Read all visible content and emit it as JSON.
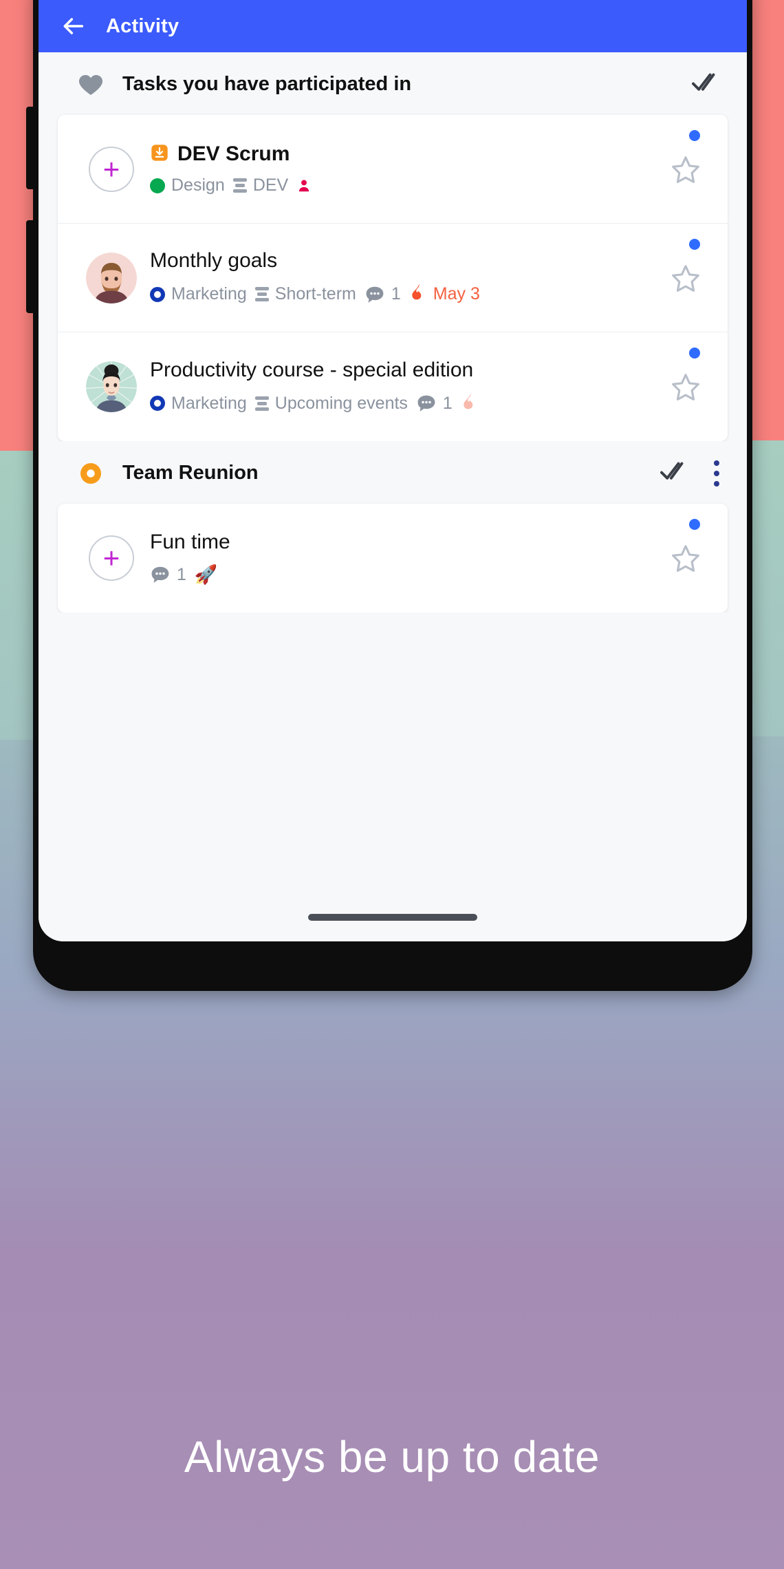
{
  "theme": {
    "accent": "#3b5bfd",
    "caption_color": "#ffffff"
  },
  "appbar": {
    "title": "Activity",
    "back_icon": "arrow-left-icon"
  },
  "sections": [
    {
      "id": "participated",
      "icon": "heart-icon",
      "icon_color": "#8a929e",
      "title": "Tasks you have participated in",
      "actions": {
        "mark_read_icon": "mark-read-icon",
        "overflow_icon": ""
      },
      "tasks": [
        {
          "avatar": "plus-icon",
          "avatar_type": "add",
          "prefix_icon": "inbox-download-icon",
          "prefix_icon_color": "#f7941d",
          "title": "DEV Scrum",
          "bold": true,
          "meta": [
            {
              "type": "status-dot",
              "color": "#06a850",
              "label": "Design"
            },
            {
              "type": "list",
              "label": "DEV"
            },
            {
              "type": "person",
              "color": "#e3004f",
              "label": ""
            }
          ],
          "star": "star-outline-icon",
          "unread": true
        },
        {
          "avatar": "avatar-man",
          "avatar_type": "photo",
          "title": "Monthly goals",
          "bold": false,
          "meta": [
            {
              "type": "status-ring",
              "color": "#1138b5",
              "label": "Marketing"
            },
            {
              "type": "list",
              "label": "Short-term"
            },
            {
              "type": "comment",
              "label": "1"
            },
            {
              "type": "due",
              "icon": "fire-icon",
              "label": "May 3",
              "color": "#f4603f"
            }
          ],
          "star": "star-outline-icon",
          "unread": true
        },
        {
          "avatar": "avatar-woman",
          "avatar_type": "photo",
          "title": "Productivity course - special edition",
          "bold": false,
          "meta": [
            {
              "type": "status-ring",
              "color": "#1138b5",
              "label": "Marketing"
            },
            {
              "type": "list",
              "label": "Upcoming events"
            },
            {
              "type": "comment",
              "label": "1"
            },
            {
              "type": "due",
              "icon": "fire-icon",
              "label": "",
              "color": "#f9b9ab"
            }
          ],
          "star": "star-outline-icon",
          "unread": true
        }
      ]
    },
    {
      "id": "team-reunion",
      "icon": "ring-icon",
      "icon_color": "#f79c1a",
      "title": "Team Reunion",
      "actions": {
        "mark_read_icon": "mark-read-icon",
        "overflow_icon": "more-vertical-icon"
      },
      "tasks": [
        {
          "avatar": "plus-icon",
          "avatar_type": "add",
          "title": "Fun time",
          "bold": false,
          "meta": [
            {
              "type": "comment",
              "label": "1"
            },
            {
              "type": "emoji",
              "label": "🚀"
            }
          ],
          "star": "star-outline-icon",
          "unread": true
        }
      ]
    }
  ],
  "home_indicator": "home-indicator",
  "caption": "Always be up to date"
}
